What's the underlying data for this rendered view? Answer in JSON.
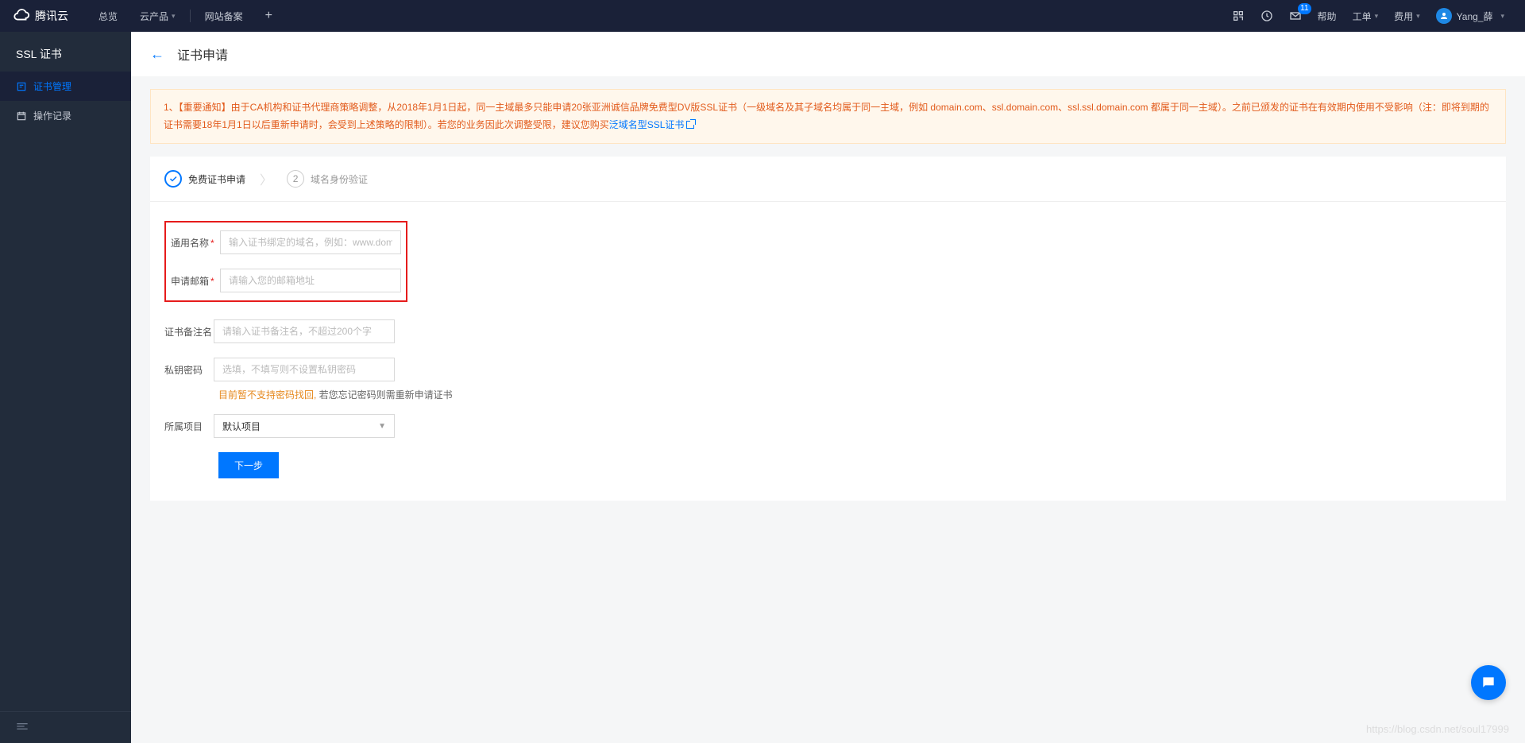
{
  "topnav": {
    "brand": "腾讯云",
    "overview": "总览",
    "products": "云产品",
    "beian": "网站备案",
    "help": "帮助",
    "tickets": "工单",
    "fees": "费用",
    "username": "Yang_薛",
    "msg_count": "11"
  },
  "sidebar": {
    "title": "SSL 证书",
    "items": [
      {
        "label": "证书管理"
      },
      {
        "label": "操作记录"
      }
    ]
  },
  "page": {
    "title": "证书申请"
  },
  "notice": {
    "text": "1、【重要通知】由于CA机构和证书代理商策略调整，从2018年1月1日起，同一主域最多只能申请20张亚洲诚信品牌免费型DV版SSL证书（一级域名及其子域名均属于同一主域，例如 domain.com、ssl.domain.com、ssl.ssl.domain.com 都属于同一主域）。之前已颁发的证书在有效期内使用不受影响（注：即将到期的证书需要18年1月1日以后重新申请时，会受到上述策略的限制）。若您的业务因此次调整受限，建议您购买",
    "link": "泛域名型SSL证书"
  },
  "steps": {
    "step1": "免费证书申请",
    "step2": "域名身份验证",
    "step2_num": "2"
  },
  "form": {
    "common_name_label": "通用名称",
    "common_name_placeholder": "输入证书绑定的域名，例如：www.domain.com",
    "email_label": "申请邮箱",
    "email_placeholder": "请输入您的邮箱地址",
    "note_label": "证书备注名",
    "note_placeholder": "请输入证书备注名，不超过200个字",
    "pwd_label": "私钥密码",
    "pwd_placeholder": "选填，不填写则不设置私钥密码",
    "pwd_hint_warn": "目前暂不支持密码找回,",
    "pwd_hint_rest": " 若您忘记密码则需重新申请证书",
    "project_label": "所属项目",
    "project_value": "默认项目",
    "submit": "下一步"
  },
  "watermark": "https://blog.csdn.net/soul17999"
}
